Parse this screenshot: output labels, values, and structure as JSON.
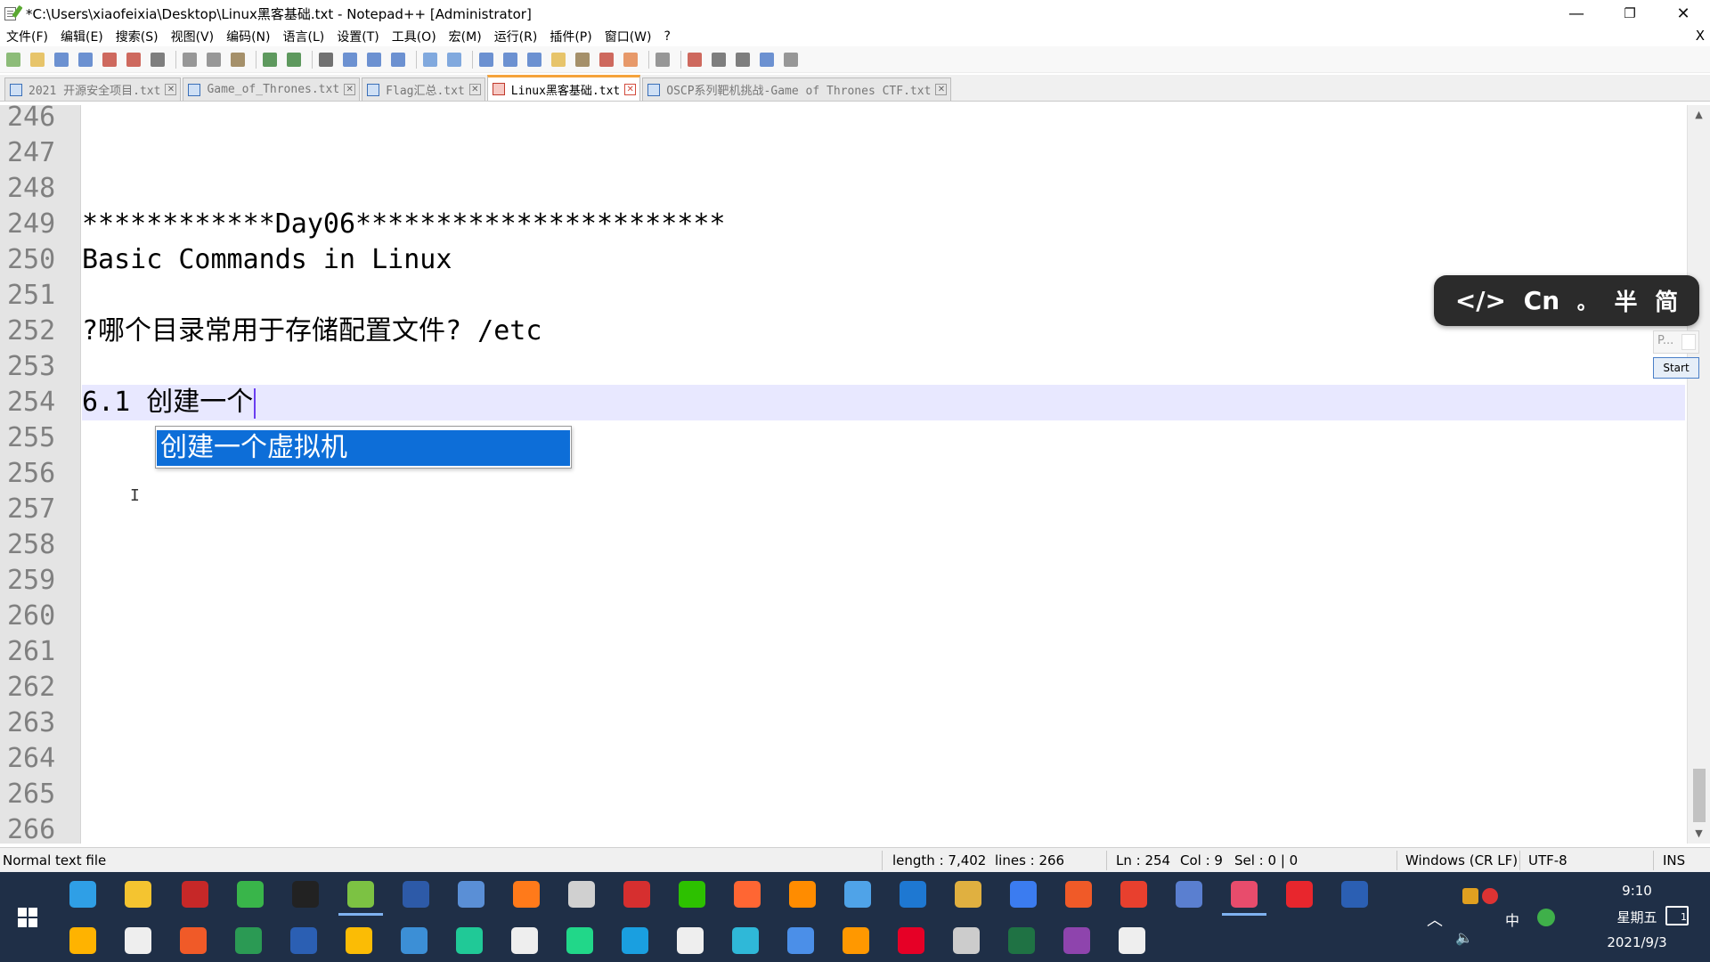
{
  "window": {
    "title": "*C:\\Users\\xiaofeixia\\Desktop\\Linux黑客基础.txt - Notepad++ [Administrator]",
    "minimize": "—",
    "restore": "❐",
    "close": "✕"
  },
  "menu": {
    "items": [
      "文件(F)",
      "编辑(E)",
      "搜索(S)",
      "视图(V)",
      "编码(N)",
      "语言(L)",
      "设置(T)",
      "工具(O)",
      "宏(M)",
      "运行(R)",
      "插件(P)",
      "窗口(W)",
      "?"
    ],
    "close": "X"
  },
  "toolbar": {
    "icons": [
      "new-file-icon",
      "open-file-icon",
      "save-icon",
      "save-all-icon",
      "close-icon",
      "close-all-icon",
      "print-icon",
      "cut-icon",
      "copy-icon",
      "paste-icon",
      "undo-icon",
      "redo-icon",
      "find-icon",
      "replace-icon",
      "zoom-in-icon",
      "zoom-out-icon",
      "sync-vertical-icon",
      "sync-horizontal-icon",
      "word-wrap-icon",
      "show-all-chars-icon",
      "indent-guide-icon",
      "language-icon",
      "doc-map-icon",
      "function-list-icon",
      "folder-workspace-icon",
      "monitor-icon",
      "record-macro-icon",
      "stop-macro-icon",
      "play-macro-icon",
      "run-macro-multiple-icon",
      "save-macro-icon"
    ]
  },
  "tabs": [
    {
      "label": "2021 开源安全项目.txt",
      "active": false
    },
    {
      "label": "Game_of_Thrones.txt",
      "active": false
    },
    {
      "label": "Flag汇总.txt",
      "active": false
    },
    {
      "label": "Linux黑客基础.txt",
      "active": true
    },
    {
      "label": "OSCP系列靶机挑战-Game of Thrones CTF.txt",
      "active": false
    }
  ],
  "editor": {
    "lines": [
      {
        "num": "246",
        "text": ""
      },
      {
        "num": "247",
        "text": ""
      },
      {
        "num": "248",
        "text": ""
      },
      {
        "num": "249",
        "text": "************Day06***********************"
      },
      {
        "num": "250",
        "text": "Basic Commands in Linux"
      },
      {
        "num": "251",
        "text": ""
      },
      {
        "num": "252",
        "text": "?哪个目录常用于存储配置文件? /etc"
      },
      {
        "num": "253",
        "text": ""
      },
      {
        "num": "254",
        "text": "6.1 创建一个"
      },
      {
        "num": "255",
        "text": ""
      },
      {
        "num": "256",
        "text": ""
      },
      {
        "num": "257",
        "text": ""
      },
      {
        "num": "258",
        "text": ""
      },
      {
        "num": "259",
        "text": ""
      },
      {
        "num": "260",
        "text": ""
      },
      {
        "num": "261",
        "text": ""
      },
      {
        "num": "262",
        "text": ""
      },
      {
        "num": "263",
        "text": ""
      },
      {
        "num": "264",
        "text": ""
      },
      {
        "num": "265",
        "text": ""
      },
      {
        "num": "266",
        "text": ""
      }
    ],
    "current_line_index": 8,
    "autocomplete_suggestion": "创建一个虚拟机"
  },
  "ime": {
    "code_symbol": "</>",
    "mode": "Cn",
    "punct": "。",
    "width": "半",
    "script": "简",
    "mini_label": "P...",
    "start_label": "Start"
  },
  "status": {
    "file_type": "Normal text file",
    "length": "length : 7,402",
    "lines": "lines : 266",
    "ln": "Ln : 254",
    "col": "Col : 9",
    "sel": "Sel : 0 | 0",
    "eol": "Windows (CR LF)",
    "encoding": "UTF-8",
    "mode": "INS"
  },
  "taskbar": {
    "top_row": [
      {
        "name": "edge-icon",
        "color": "#2f9fe6"
      },
      {
        "name": "file-explorer-icon",
        "color": "#f4c430"
      },
      {
        "name": "red-app-icon",
        "color": "#c62828"
      },
      {
        "name": "c-app-icon",
        "color": "#39b54a"
      },
      {
        "name": "qq-icon",
        "color": "#222222"
      },
      {
        "name": "notepadpp-icon",
        "color": "#7cc243"
      },
      {
        "name": "powershell-icon",
        "color": "#2d5aa8"
      },
      {
        "name": "network-icon",
        "color": "#5a8fd6"
      },
      {
        "name": "firefox-icon",
        "color": "#ff7a1a"
      },
      {
        "name": "window-app-icon",
        "color": "#d0d0d0"
      },
      {
        "name": "filezilla-icon",
        "color": "#d62f2f"
      },
      {
        "name": "wechat-icon",
        "color": "#2dc100"
      },
      {
        "name": "burp-icon",
        "color": "#ff6633"
      },
      {
        "name": "search-tool-icon",
        "color": "#ff8c00"
      },
      {
        "name": "share-icon",
        "color": "#4fa3e8"
      },
      {
        "name": "wireshark-icon",
        "color": "#1e78d2"
      },
      {
        "name": "books-icon",
        "color": "#e0b040"
      },
      {
        "name": "baidu-pan-icon",
        "color": "#3b7cf0"
      },
      {
        "name": "s-app-icon",
        "color": "#f05a28"
      },
      {
        "name": "swirl-app-icon",
        "color": "#e8402e"
      },
      {
        "name": "save-app-icon",
        "color": "#5a7fd0"
      },
      {
        "name": "snipping-icon",
        "color": "#e84c6c"
      },
      {
        "name": "youdao-icon",
        "color": "#e8262d"
      },
      {
        "name": "vscode-like-icon",
        "color": "#2b5fb3"
      }
    ],
    "bottom_row": [
      {
        "name": "sync-app-icon",
        "color": "#ffb300"
      },
      {
        "name": "lock-app-icon",
        "color": "#eeeeee"
      },
      {
        "name": "c-red-app-icon",
        "color": "#f05a28"
      },
      {
        "name": "multi-window-icon",
        "color": "#2b9a54"
      },
      {
        "name": "word-icon",
        "color": "#2b5fb3"
      },
      {
        "name": "chrome-icon",
        "color": "#fbbc05"
      },
      {
        "name": "remote-desktop-icon",
        "color": "#3c8fd6"
      },
      {
        "name": "m-app-icon",
        "color": "#20c997"
      },
      {
        "name": "document-icon",
        "color": "#eeeeee"
      },
      {
        "name": "pycharm-icon",
        "color": "#21d789"
      },
      {
        "name": "photoshop-like-icon",
        "color": "#1a9fe0"
      },
      {
        "name": "vmware-icon",
        "color": "#eeeeee"
      },
      {
        "name": "cloud-app-icon",
        "color": "#2fb8d8"
      },
      {
        "name": "swift-app-icon",
        "color": "#4b8fe8"
      },
      {
        "name": "sublime-icon",
        "color": "#ff9800"
      },
      {
        "name": "netease-music-icon",
        "color": "#e60026"
      },
      {
        "name": "game-app-icon",
        "color": "#cccccc"
      },
      {
        "name": "excel-icon",
        "color": "#1f7244"
      },
      {
        "name": "pdf-app-icon",
        "color": "#8e44ad"
      },
      {
        "name": "mascot-app-icon",
        "color": "#eeeeee"
      }
    ],
    "tray": {
      "ime_lang": "中",
      "time": "9:10",
      "weekday": "星期五",
      "date": "2021/9/3",
      "notifications": "1"
    }
  }
}
